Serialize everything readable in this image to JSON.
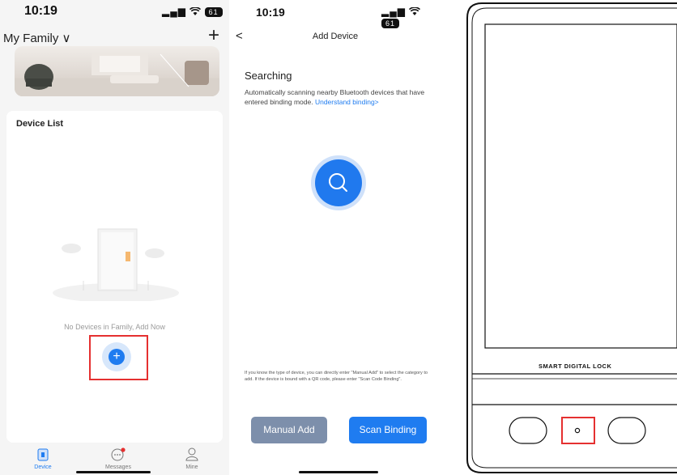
{
  "screen1": {
    "status": {
      "time": "10:19",
      "battery": "61"
    },
    "family_label": "My Family ∨",
    "add_label": "+",
    "device_list_title": "Device List",
    "empty_text": "No Devices in Family, Add Now",
    "add_device_label": "+",
    "tabs": [
      {
        "label": "Device",
        "icon": "device-icon"
      },
      {
        "label": "Messages",
        "icon": "messages-icon"
      },
      {
        "label": "Mine",
        "icon": "person-icon"
      }
    ]
  },
  "screen2": {
    "status": {
      "time": "10:19",
      "battery": "61"
    },
    "back_label": "<",
    "title": "Add Device",
    "searching_title": "Searching",
    "description": "Automatically scanning nearby Bluetooth devices that have entered binding mode. ",
    "description_link": "Understand binding>",
    "hint": "If you know the type of device, you can directly enter \"Manual Add\" to select the category to add. If the device is bound with a QR code, please enter \"Scan Code Binding\".",
    "manual_add_label": "Manual Add",
    "scan_binding_label": "Scan Binding",
    "colors": {
      "primary": "#1f7cf0",
      "secondary": "#7d8fab",
      "highlight": "#e53030"
    }
  },
  "lock": {
    "label": "SMART DIGITAL LOCK"
  }
}
